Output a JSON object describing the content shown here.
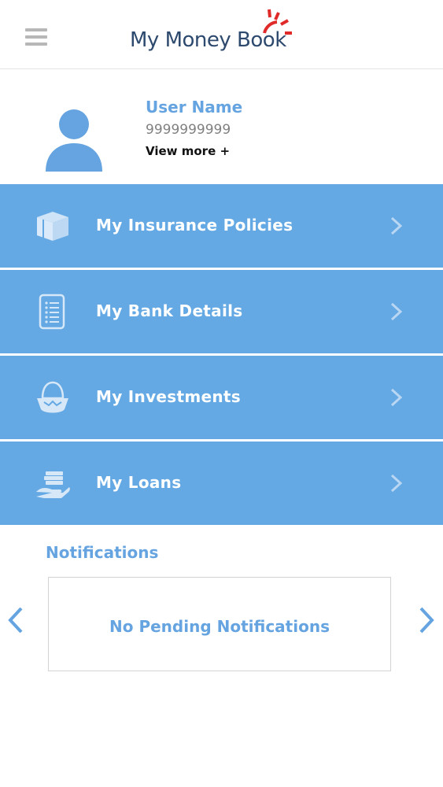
{
  "header": {
    "menu_icon": "hamburger-menu-icon",
    "logo_text": "My Money Book",
    "logo_accent_color": "#e02a2a"
  },
  "profile": {
    "avatar_icon": "user-avatar-icon",
    "name": "User Name",
    "phone": "9999999999",
    "view_more": "View more +"
  },
  "menu": {
    "items": [
      {
        "label": "My Insurance Policies",
        "icon": "box-icon"
      },
      {
        "label": "My Bank Details",
        "icon": "document-list-icon"
      },
      {
        "label": "My Investments",
        "icon": "money-bag-icon"
      },
      {
        "label": "My Loans",
        "icon": "hand-cash-icon"
      }
    ],
    "background_color": "#65a9e4"
  },
  "notifications": {
    "title": "Notifications",
    "empty_message": "No Pending Notifications",
    "prev_icon": "chevron-left-icon",
    "next_icon": "chevron-right-icon"
  },
  "colors": {
    "accent": "#65a4e0",
    "text_dark": "#111111",
    "text_muted": "#808080"
  }
}
